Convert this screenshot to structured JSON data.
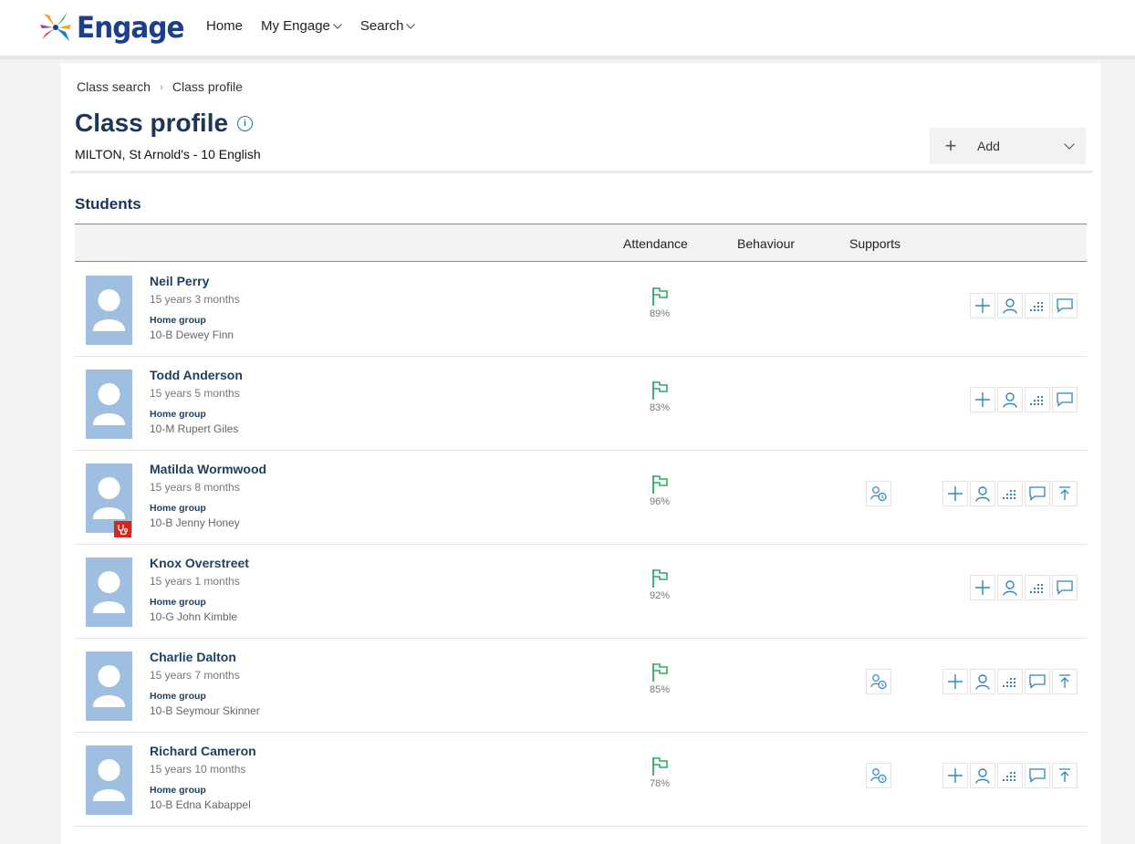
{
  "app": {
    "logo_text": "Engage"
  },
  "nav": {
    "home": "Home",
    "my_engage": "My Engage",
    "search": "Search"
  },
  "breadcrumb": {
    "item1": "Class search",
    "item2": "Class profile"
  },
  "page": {
    "title": "Class profile",
    "info_glyph": "i",
    "subtitle": "MILTON, St Arnold's - 10 English",
    "add_label": "Add",
    "add_icon": "+"
  },
  "students_section": {
    "title": "Students",
    "columns": {
      "attendance": "Attendance",
      "behaviour": "Behaviour",
      "supports": "Supports"
    },
    "home_group_label": "Home group"
  },
  "students": [
    {
      "name": "Neil Perry",
      "age": "15 years 3 months",
      "home_group": "10-B Dewey Finn",
      "attendance": "89%",
      "medical": false,
      "support": false
    },
    {
      "name": "Todd Anderson",
      "age": "15 years 5 months",
      "home_group": "10-M Rupert Giles",
      "attendance": "83%",
      "medical": false,
      "support": false
    },
    {
      "name": "Matilda Wormwood",
      "age": "15 years 8 months",
      "home_group": "10-B Jenny Honey",
      "attendance": "96%",
      "medical": true,
      "support": true
    },
    {
      "name": "Knox Overstreet",
      "age": "15 years 1 months",
      "home_group": "10-G John Kimble",
      "attendance": "92%",
      "medical": false,
      "support": false
    },
    {
      "name": "Charlie Dalton",
      "age": "15 years 7 months",
      "home_group": "10-B Seymour Skinner",
      "attendance": "85%",
      "medical": false,
      "support": true
    },
    {
      "name": "Richard Cameron",
      "age": "15 years 10 months",
      "home_group": "10-B Edna Kabappel",
      "attendance": "78%",
      "medical": false,
      "support": true
    }
  ],
  "colors": {
    "brand": "#1b3f8b",
    "heading": "#1d3557",
    "attendance_flag": "#2bab64",
    "action_icon": "#2f86b8",
    "avatar_bg": "#9fbfe0",
    "medical_badge": "#d9261c"
  },
  "icons": {
    "attendance": "flag-icon",
    "support": "support-plan-icon",
    "actions": [
      "plus-icon",
      "person-icon",
      "chart-dots-icon",
      "comment-icon",
      "upload-icon"
    ],
    "medical": "stethoscope-icon"
  }
}
